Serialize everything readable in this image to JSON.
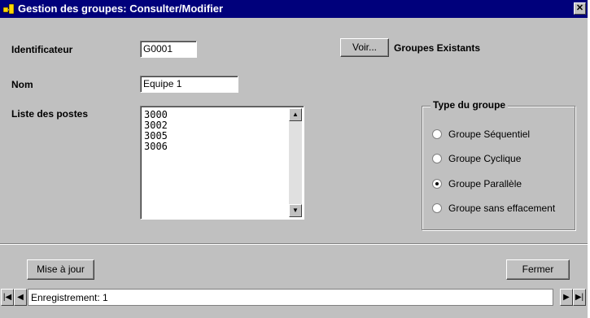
{
  "window": {
    "title": "Gestion des groupes: Consulter/Modifier",
    "close_glyph": "✕"
  },
  "form": {
    "identificateur": {
      "label": "Identificateur",
      "value": "G0001"
    },
    "voir_button": "Voir...",
    "groupes_existants": "Groupes Existants",
    "nom": {
      "label": "Nom",
      "value": "Equipe 1"
    },
    "liste_postes": {
      "label": "Liste des postes",
      "items": [
        "3000",
        "3002",
        "3005",
        "3006"
      ]
    }
  },
  "type_groupe": {
    "title": "Type du groupe",
    "options": [
      {
        "label": "Groupe Séquentiel",
        "selected": false
      },
      {
        "label": "Groupe Cyclique",
        "selected": false
      },
      {
        "label": "Groupe Parallèle",
        "selected": true
      },
      {
        "label": "Groupe sans effacement",
        "selected": false
      }
    ]
  },
  "footer": {
    "mise_a_jour": "Mise à jour",
    "fermer": "Fermer"
  },
  "navigator": {
    "record_text": "Enregistrement: 1"
  },
  "colors": {
    "titlebar": "#00007b",
    "face": "#c0c0c0"
  }
}
